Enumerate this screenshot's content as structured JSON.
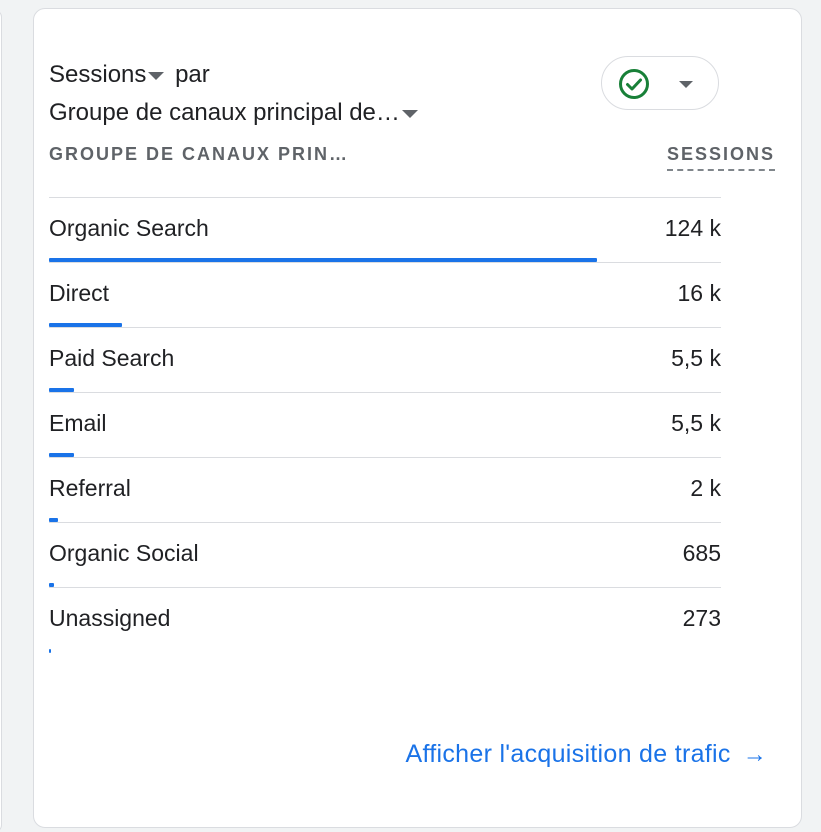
{
  "card": {
    "title_metric": "Sessions",
    "title_connector": "par",
    "title_dimension": "Groupe de canaux principal de…"
  },
  "table": {
    "dimension_header": "GROUPE DE CANAUX PRIN…",
    "metric_header": "SESSIONS",
    "rows": [
      {
        "label": "Organic Search",
        "value": "124 k",
        "share": 1.0
      },
      {
        "label": "Direct",
        "value": "16 k",
        "share": 0.134
      },
      {
        "label": "Paid Search",
        "value": "5,5 k",
        "share": 0.046
      },
      {
        "label": "Email",
        "value": "5,5 k",
        "share": 0.046
      },
      {
        "label": "Referral",
        "value": "2 k",
        "share": 0.017
      },
      {
        "label": "Organic Social",
        "value": "685",
        "share": 0.009
      },
      {
        "label": "Unassigned",
        "value": "273",
        "share": 0.004
      }
    ]
  },
  "footer": {
    "link_label": "Afficher l'acquisition de trafic",
    "arrow_icon": "→"
  },
  "colors": {
    "accent": "#1a73e8",
    "success": "#188038"
  },
  "icons": [
    "check-circle-icon",
    "chevron-down-icon",
    "arrow-right-icon"
  ]
}
